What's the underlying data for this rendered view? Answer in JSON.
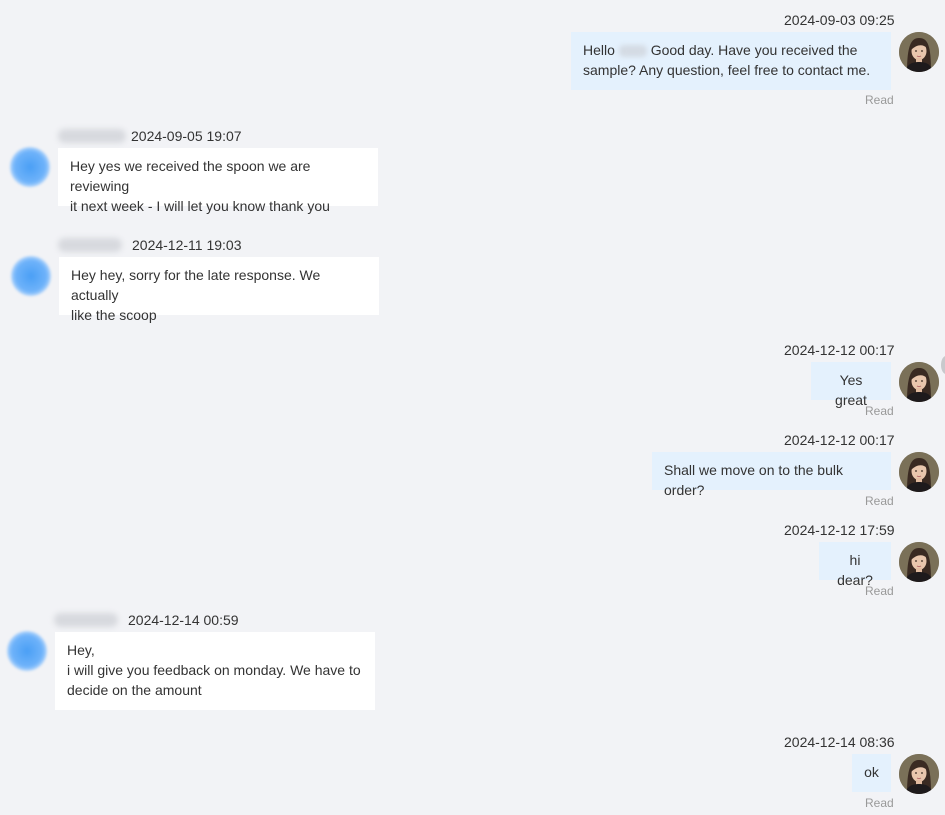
{
  "read_label": "Read",
  "me": {
    "avatar_icon": "woman-portrait-icon"
  },
  "them": {
    "avatar_icon": "blurred-avatar-icon"
  },
  "messages": [
    {
      "dir": "out",
      "time": "2024-09-03 09:25",
      "text_before": "Hello",
      "text_after": "Good day. Have you received the",
      "text_line2": "sample? Any question, feel free to contact me.",
      "status": "Read"
    },
    {
      "dir": "in",
      "time": "2024-09-05 19:07",
      "line1": "Hey yes we received the spoon we are reviewing",
      "line2": "it next week - I will let you know thank you"
    },
    {
      "dir": "in",
      "time": "2024-12-11 19:03",
      "line1": "Hey hey, sorry for the late response. We actually",
      "line2": "like the scoop"
    },
    {
      "dir": "out",
      "time": "2024-12-12 00:17",
      "text": "Yes great",
      "status": "Read"
    },
    {
      "dir": "out",
      "time": "2024-12-12 00:17",
      "text": "Shall we move on to the bulk order?",
      "status": "Read"
    },
    {
      "dir": "out",
      "time": "2024-12-12 17:59",
      "text": "hi dear?",
      "status": "Read"
    },
    {
      "dir": "in",
      "time": "2024-12-14 00:59",
      "line1": "Hey,",
      "line2": "i will give you feedback on monday. We have to",
      "line3": "decide on the amount"
    },
    {
      "dir": "out",
      "time": "2024-12-14 08:36",
      "text": "ok",
      "status": "Read"
    }
  ]
}
